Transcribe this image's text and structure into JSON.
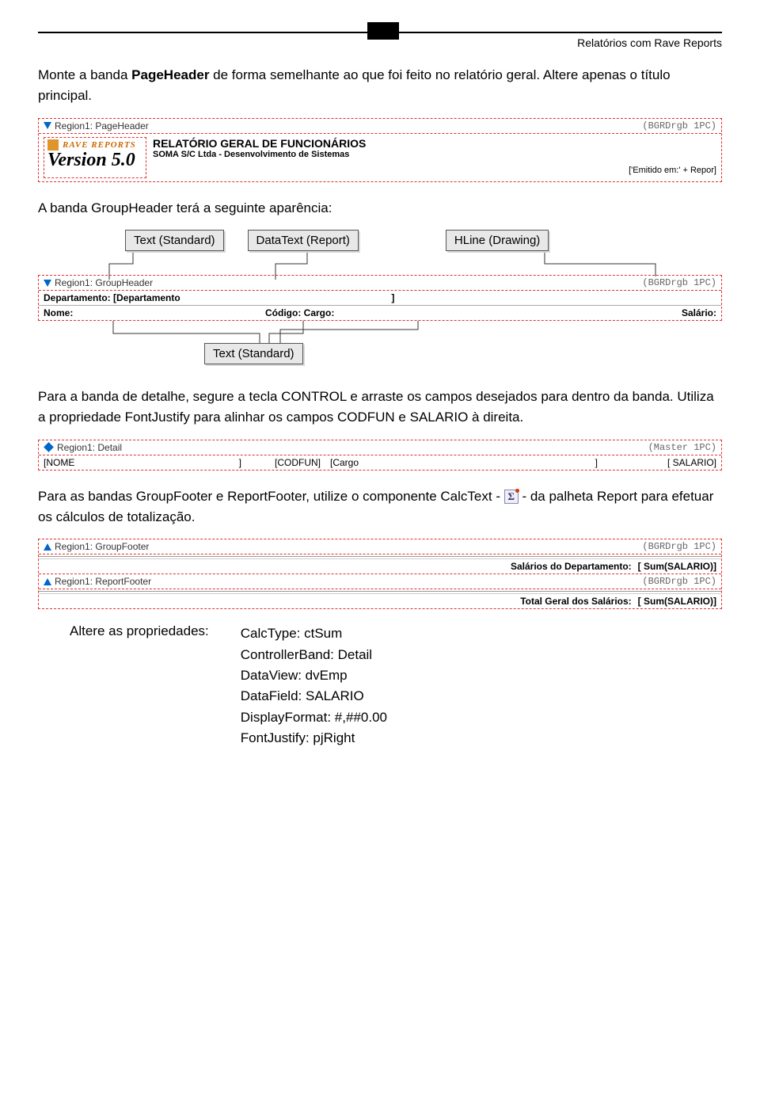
{
  "header": {
    "caption": "Relatórios com Rave Reports"
  },
  "para1": {
    "prefix": "Monte a banda ",
    "bold": "PageHeader",
    "suffix": " de forma semelhante ao que foi feito no relatório geral. Altere apenas o título principal."
  },
  "designer1": {
    "band": {
      "label": "Region1: PageHeader",
      "tag": "(BGRDrgb 1PC)"
    },
    "logo": {
      "line1": "RAVE REPORTS",
      "line2": "Version 5.0"
    },
    "title": "RELATÓRIO GERAL DE FUNCIONÁRIOS",
    "subtitle": "SOMA S/C Ltda - Desenvolvimento de Sistemas",
    "emitted": "['Emitido em:' + Repor]"
  },
  "para2": "A banda GroupHeader terá a seguinte aparência:",
  "callouts": {
    "c1": "Text (Standard)",
    "c2": "DataText (Report)",
    "c3": "HLine (Drawing)",
    "c4": "Text (Standard)"
  },
  "designer2": {
    "band": {
      "label": "Region1: GroupHeader",
      "tag": "(BGRDrgb 1PC)"
    },
    "row1": {
      "label": "Departamento:",
      "field": "[Departamento",
      "close": "]"
    },
    "row2": {
      "nome": "Nome:",
      "codigo": "Código:",
      "cargo": "Cargo:",
      "salario": "Salário:"
    }
  },
  "para3": "Para a banda de detalhe, segure a tecla CONTROL e arraste os campos desejados para dentro da banda. Utiliza a propriedade FontJustify para alinhar os campos CODFUN e SALARIO à direita.",
  "designer3": {
    "band": {
      "label": "Region1: Detail",
      "tag": "(Master 1PC)"
    },
    "fields": {
      "nome": "[NOME",
      "nome_close": "]",
      "cod": "[CODFUN]",
      "cargo": "[Cargo",
      "cargo_close": "]",
      "sal_open": "[",
      "sal": "SALARIO]"
    }
  },
  "para4": {
    "prefix": "Para as bandas GroupFooter e ReportFooter, utilize o componente CalcText - ",
    "suffix": " - da palheta Report para efetuar os cálculos de totalização."
  },
  "designer4": {
    "band1": {
      "label": "Region1: GroupFooter",
      "tag": "(BGRDrgb 1PC)"
    },
    "row1": {
      "label": "Salários do Departamento:",
      "val": "[   Sum(SALARIO)]"
    },
    "band2": {
      "label": "Region1: ReportFooter",
      "tag": "(BGRDrgb 1PC)"
    },
    "row2": {
      "label": "Total Geral dos Salários:",
      "val": "[   Sum(SALARIO)]"
    }
  },
  "props": {
    "heading": "Altere as propriedades:",
    "lines": {
      "l1": "CalcType: ctSum",
      "l2": "ControllerBand: Detail",
      "l3": "DataView: dvEmp",
      "l4": "DataField: SALARIO",
      "l5": "DisplayFormat: #,##0.00",
      "l6": "FontJustify: pjRight"
    }
  }
}
